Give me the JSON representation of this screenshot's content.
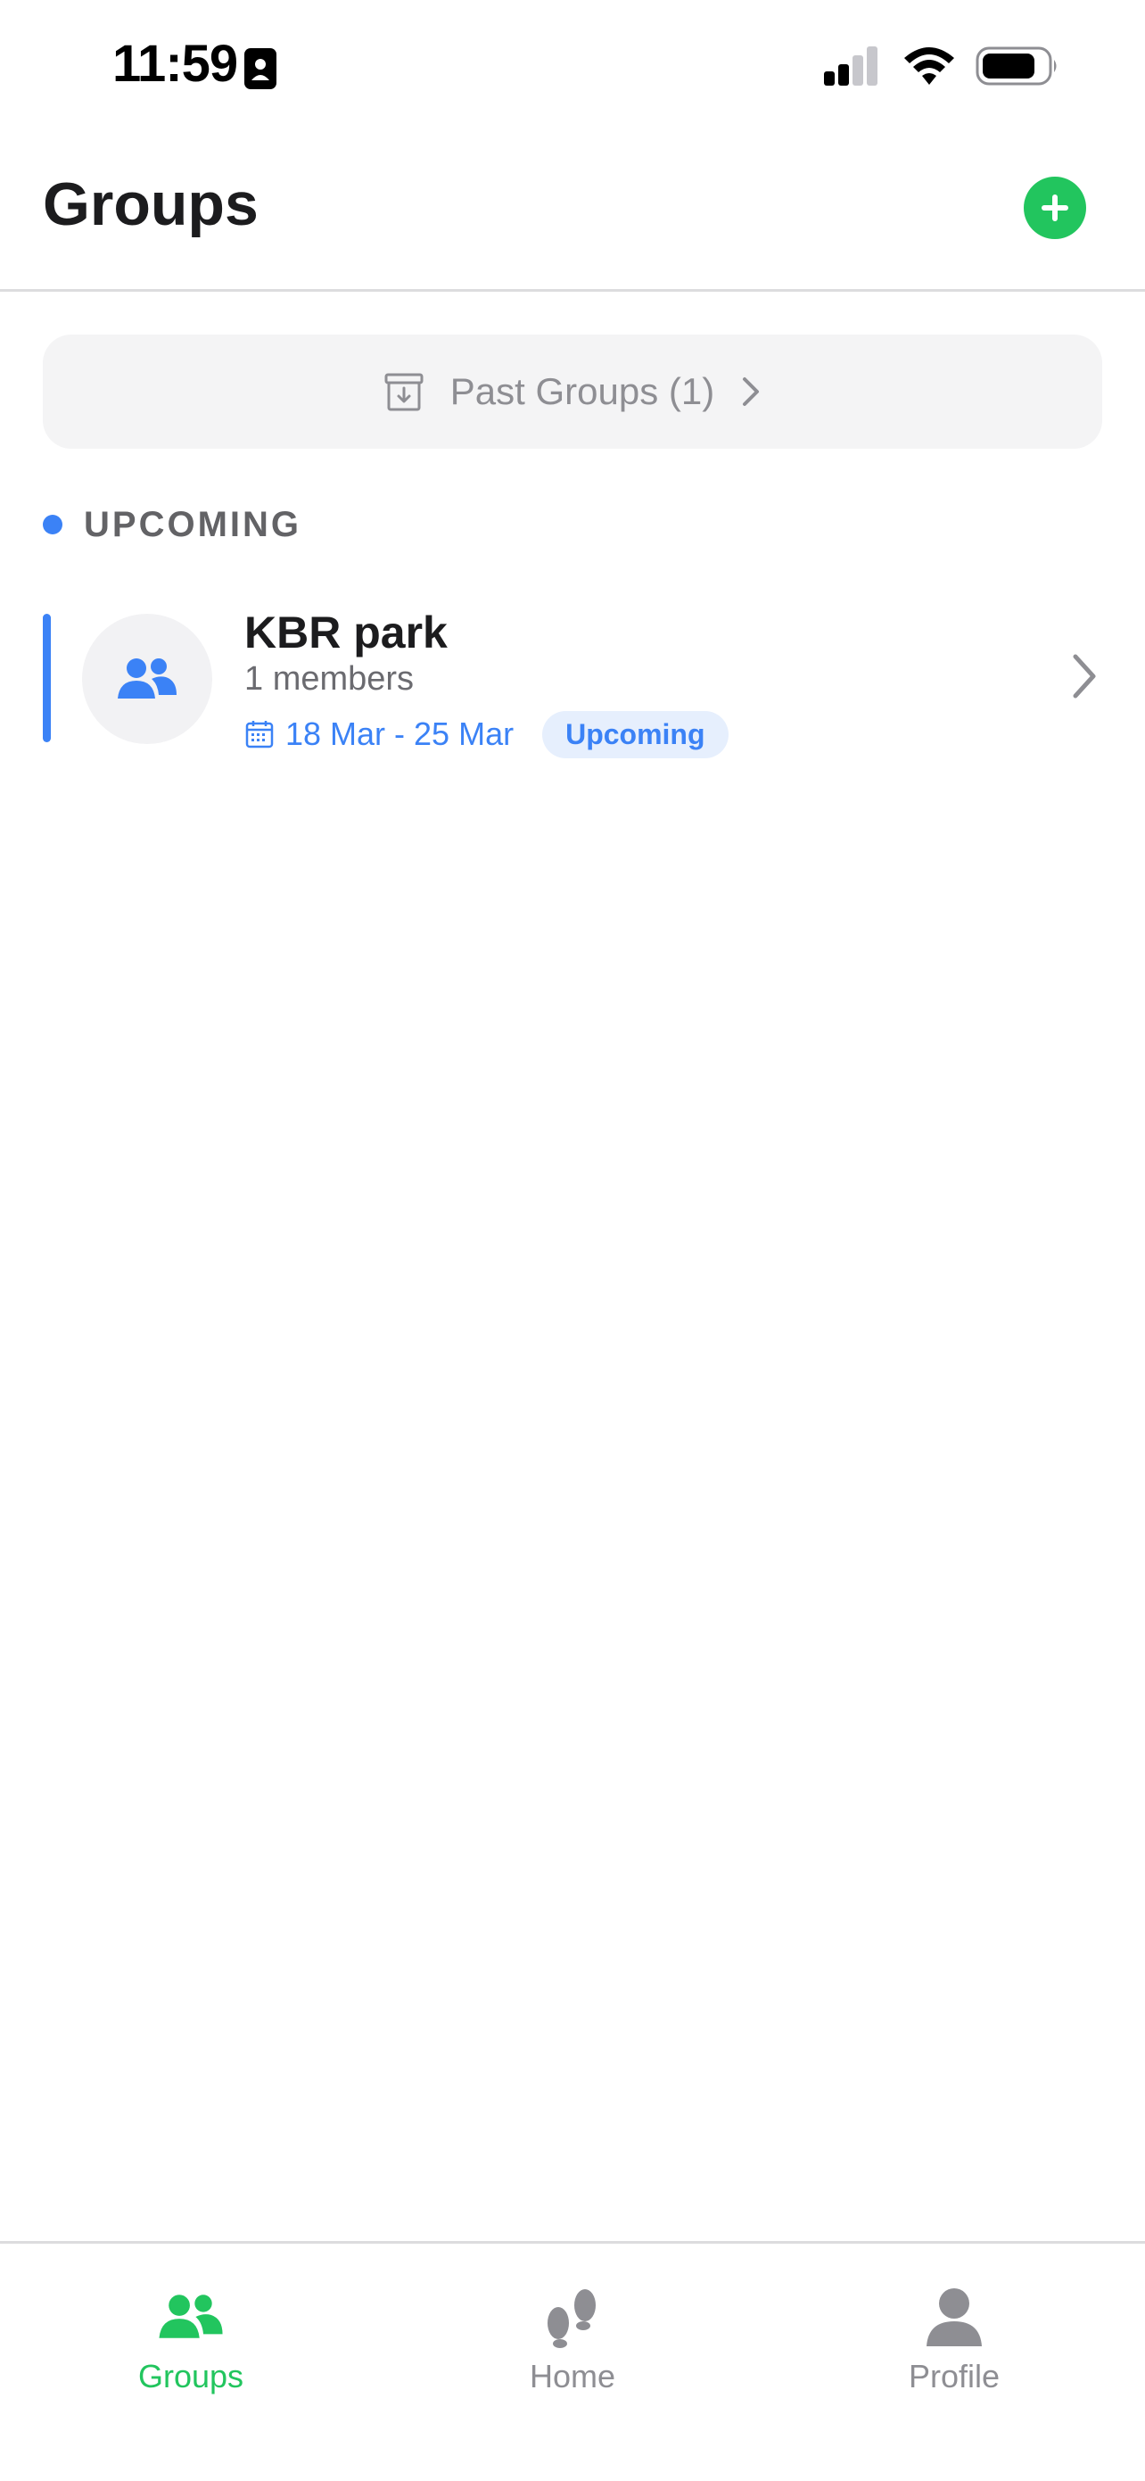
{
  "status_bar": {
    "time": "11:59"
  },
  "header": {
    "title": "Groups",
    "add_icon": "plus-circle-icon"
  },
  "past_groups": {
    "label": "Past Groups (1)",
    "icon": "archive-icon"
  },
  "section": {
    "label": "UPCOMING",
    "accent_color": "#3b82f6"
  },
  "groups": [
    {
      "name": "KBR park",
      "members": "1 members",
      "dates": "18 Mar - 25 Mar",
      "status": "Upcoming",
      "icon": "users-icon"
    }
  ],
  "tab_bar": {
    "tabs": [
      {
        "label": "Groups",
        "icon": "users-icon",
        "active": true
      },
      {
        "label": "Home",
        "icon": "footprints-icon",
        "active": false
      },
      {
        "label": "Profile",
        "icon": "person-icon",
        "active": false
      }
    ]
  },
  "colors": {
    "brand_green": "#22c55e",
    "accent_blue": "#3b82f6",
    "muted_gray": "#8e8e93"
  }
}
